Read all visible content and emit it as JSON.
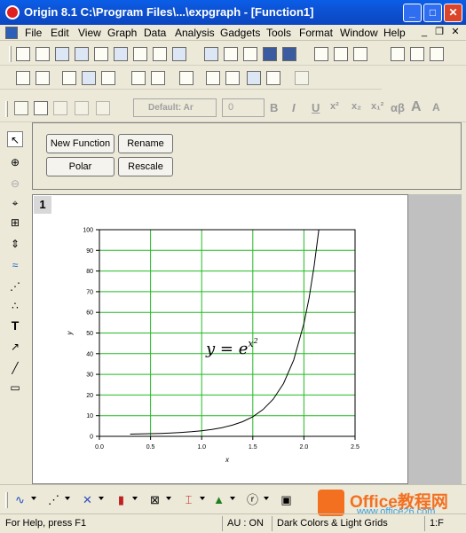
{
  "window": {
    "title": "Origin 8.1 C:\\Program Files\\...\\expgraph - [Function1]"
  },
  "menu": [
    "File",
    "Edit",
    "View",
    "Graph",
    "Data",
    "Analysis",
    "Gadgets",
    "Tools",
    "Format",
    "Window",
    "Help"
  ],
  "format_toolbar": {
    "font": "Default: Ar",
    "size": "0",
    "bold": "B",
    "italic": "I",
    "underline": "U",
    "superscript": "x²",
    "subscript": "x₂",
    "supsub": "x₁²",
    "greek": "αβ",
    "grow": "A",
    "shrink": "A"
  },
  "buttons": {
    "new_function": "New Function",
    "rename": "Rename",
    "polar": "Polar",
    "rescale": "Rescale"
  },
  "graph": {
    "page_number": "1",
    "formula": "y = e",
    "formula_exp": "x",
    "formula_exp2": "2"
  },
  "chart_data": {
    "type": "line",
    "xlabel": "x",
    "ylabel": "y",
    "xlim": [
      0,
      2.5
    ],
    "ylim": [
      0,
      100
    ],
    "xticks": [
      "0.0",
      "0.5",
      "1.0",
      "1.5",
      "2.0",
      "2.5"
    ],
    "yticks": [
      "0",
      "10",
      "20",
      "30",
      "40",
      "50",
      "60",
      "70",
      "80",
      "90",
      "100"
    ],
    "grid": true,
    "grid_color": "#22bb22",
    "line_color": "#000000",
    "series": [
      {
        "x": [
          0.3,
          0.4,
          0.5,
          0.6,
          0.7,
          0.8,
          0.9,
          1.0,
          1.1,
          1.2,
          1.3,
          1.4,
          1.5,
          1.6,
          1.7,
          1.8,
          1.9,
          2.0,
          2.05,
          2.1,
          2.146
        ],
        "y": [
          1.09,
          1.17,
          1.28,
          1.43,
          1.63,
          1.9,
          2.25,
          2.72,
          3.35,
          4.22,
          5.42,
          7.1,
          9.49,
          12.94,
          17.99,
          25.53,
          36.97,
          54.6,
          66.85,
          82.44,
          100.0
        ]
      }
    ]
  },
  "statusbar": {
    "help": "For Help, press F1",
    "au": "AU : ON",
    "theme": "Dark Colors & Light Grids",
    "page": "1:F"
  },
  "watermark": {
    "brand": "Office教程网",
    "url": "www.office26.com"
  }
}
